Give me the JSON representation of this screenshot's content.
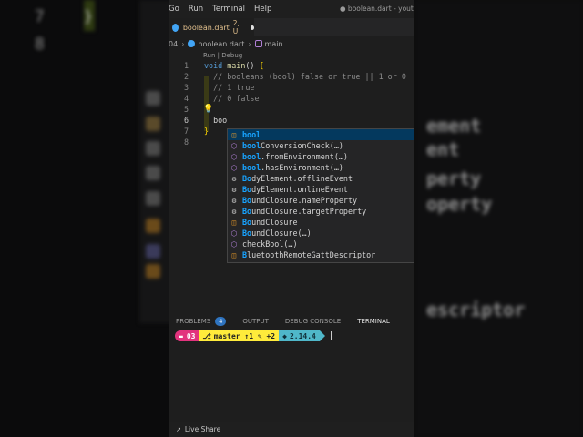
{
  "menu": {
    "items": [
      "Go",
      "Run",
      "Terminal",
      "Help"
    ],
    "title": "● boolean.dart - youtub"
  },
  "tab": {
    "name": "boolean.dart",
    "status": "2, U"
  },
  "breadcrumb": {
    "folder": "04",
    "file": "boolean.dart",
    "symbol": "main"
  },
  "codelens": "Run | Debug",
  "code": {
    "lines": [
      {
        "num": "1",
        "parts": [
          [
            "kw",
            "void "
          ],
          [
            "fn",
            "main"
          ],
          [
            "pn",
            "() "
          ],
          [
            "br",
            "{"
          ]
        ]
      },
      {
        "num": "2",
        "parts": [
          [
            "cm",
            "  // booleans (bool) false or true || 1 or 0"
          ]
        ]
      },
      {
        "num": "3",
        "parts": [
          [
            "cm",
            "  // 1 true"
          ]
        ]
      },
      {
        "num": "4",
        "parts": [
          [
            "cm",
            "  // 0 false"
          ]
        ]
      },
      {
        "num": "5",
        "parts": []
      },
      {
        "num": "6",
        "parts": [
          [
            "tx",
            "  boo"
          ]
        ]
      },
      {
        "num": "7",
        "parts": [
          [
            "br",
            "}"
          ]
        ]
      },
      {
        "num": "8",
        "parts": []
      }
    ]
  },
  "suggestions": [
    {
      "icon": "class",
      "match": "bool",
      "rest": "",
      "selected": true
    },
    {
      "icon": "method",
      "match": "bool",
      "rest": "ConversionCheck(…)"
    },
    {
      "icon": "method",
      "match": "bool",
      "rest": ".fromEnvironment(…)"
    },
    {
      "icon": "method",
      "match": "bool",
      "rest": ".hasEnvironment(…)"
    },
    {
      "icon": "prop",
      "match": "Bo",
      "rest": "dyElement.offlineEvent"
    },
    {
      "icon": "prop",
      "match": "Bo",
      "rest": "dyElement.onlineEvent"
    },
    {
      "icon": "prop",
      "match": "Bo",
      "rest": "undClosure.nameProperty"
    },
    {
      "icon": "prop",
      "match": "Bo",
      "rest": "undClosure.targetProperty"
    },
    {
      "icon": "class",
      "match": "Bo",
      "rest": "undClosure"
    },
    {
      "icon": "method",
      "match": "Bo",
      "rest": "undClosure(…)"
    },
    {
      "icon": "method",
      "match": "",
      "rest": "checkBool(…)"
    },
    {
      "icon": "class",
      "match": "B",
      "rest": "luetoothRemoteGattDescriptor"
    }
  ],
  "panel": {
    "tabs": [
      "PROBLEMS",
      "OUTPUT",
      "DEBUG CONSOLE",
      "TERMINAL"
    ],
    "problems_count": "4",
    "prompt": {
      "folder": "03",
      "git": "master ↑1 ✎ +2",
      "version": "2.14.4"
    }
  },
  "statusbar": {
    "live_share": "Live Share"
  },
  "background": {
    "line_numbers": [
      "7",
      "8"
    ],
    "words": [
      "ement",
      "ent",
      "perty",
      "operty",
      "escriptor"
    ]
  },
  "colors": {
    "accent": "#18a3ff",
    "selection": "#04395e",
    "editor_bg": "#1e1e1e"
  }
}
